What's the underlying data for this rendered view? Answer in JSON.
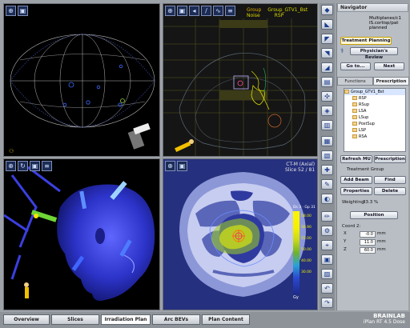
{
  "viewports": {
    "top_right": {
      "caption_group": "Group_GTV1_Bst",
      "caption_noise": "Noise",
      "caption_rsp": "RSP"
    },
    "bottom_right": {
      "caption_title": "CT-M (Axial)",
      "caption_slice": "Slice 52 / 81",
      "legend_header": "Ds 3 · Gp 31",
      "legend_values": [
        "58.00",
        "56.90",
        "55.00",
        "50.00",
        "40.00",
        "30.00"
      ],
      "legend_unit": "Gy"
    }
  },
  "navigator": {
    "title": "Navigator",
    "info": [
      "Multiplanes/c1",
      "IS.cortisp/pat",
      "planned"
    ],
    "treatment_planning": "Treatment Planning",
    "physicians_review": "Physician's Review",
    "goto": "Go to...",
    "next": "Next"
  },
  "functions": {
    "tabs": [
      "Functions",
      "Prescription"
    ],
    "tree": {
      "root": "Group_GTV1_Bst",
      "children": [
        "RSP",
        "RSup",
        "LSA",
        "LSup",
        "PostSup",
        "LSP",
        "RSA"
      ]
    },
    "refresh_label": "Refresh MU",
    "prescription_label": "Prescription",
    "treatment_group_label": "Treatment Group",
    "add_beam": "Add Beam",
    "find": "Find",
    "properties": "Properties",
    "delete": "Delete",
    "weighting_label": "Weighting:",
    "weighting_value": "33.3 %",
    "position": "Position",
    "coord_label": "Coord 2:",
    "coords": [
      {
        "axis": "X",
        "value": "-0.0",
        "unit": "mm"
      },
      {
        "axis": "Y",
        "value": "11.0",
        "unit": "mm"
      },
      {
        "axis": "Z",
        "value": "60.0",
        "unit": "mm"
      }
    ]
  },
  "bottom_tabs": [
    "Overview",
    "Slices",
    "Irradiation Plan",
    "Arc BEVs",
    "Plan Content"
  ],
  "brand": {
    "name": "BRAINLAB",
    "product": "iPlan RT 4.5 Dose"
  }
}
